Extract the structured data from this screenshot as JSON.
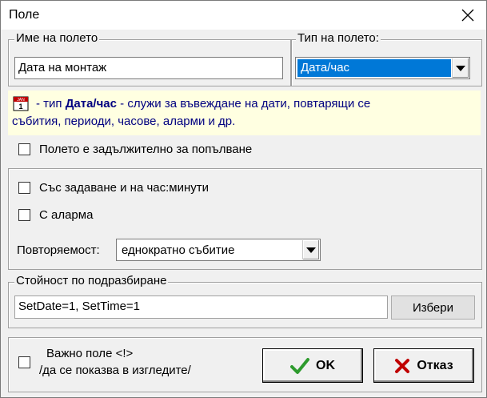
{
  "window": {
    "title": "Поле"
  },
  "field_name": {
    "legend": "Име на полето",
    "value": "Дата на монтаж"
  },
  "field_type": {
    "legend": "Тип на полето:",
    "selected": "Дата/час"
  },
  "info": {
    "prefix": "- тип ",
    "type_name": "Дата/час",
    "line1_rest": " - служи за въвеждане на дати, повтарящи се",
    "line2": "събития, периоди, часове, аларми и др."
  },
  "required": {
    "label": "Полето е задължително за попълване",
    "checked": false
  },
  "options": {
    "time_label": "Със задаване и на час:минути",
    "time_checked": false,
    "alarm_label": "С аларма",
    "alarm_checked": false,
    "repeat_label": "Повторяемост:",
    "repeat_value": "еднократно събитие"
  },
  "default": {
    "legend": "Стойност по подразбиране",
    "value": "SetDate=1, SetTime=1",
    "choose_label": "Избери"
  },
  "important": {
    "line1": "Важно поле <!>",
    "line2": "/да се показва в изгледите/",
    "checked": false
  },
  "buttons": {
    "ok": "OK",
    "cancel": "Отказ"
  },
  "colors": {
    "selection": "#0078d7",
    "info_bg": "#ffffe1",
    "info_text": "#000080",
    "ok_check": "#2e9b2e",
    "cancel_x": "#c00000"
  }
}
